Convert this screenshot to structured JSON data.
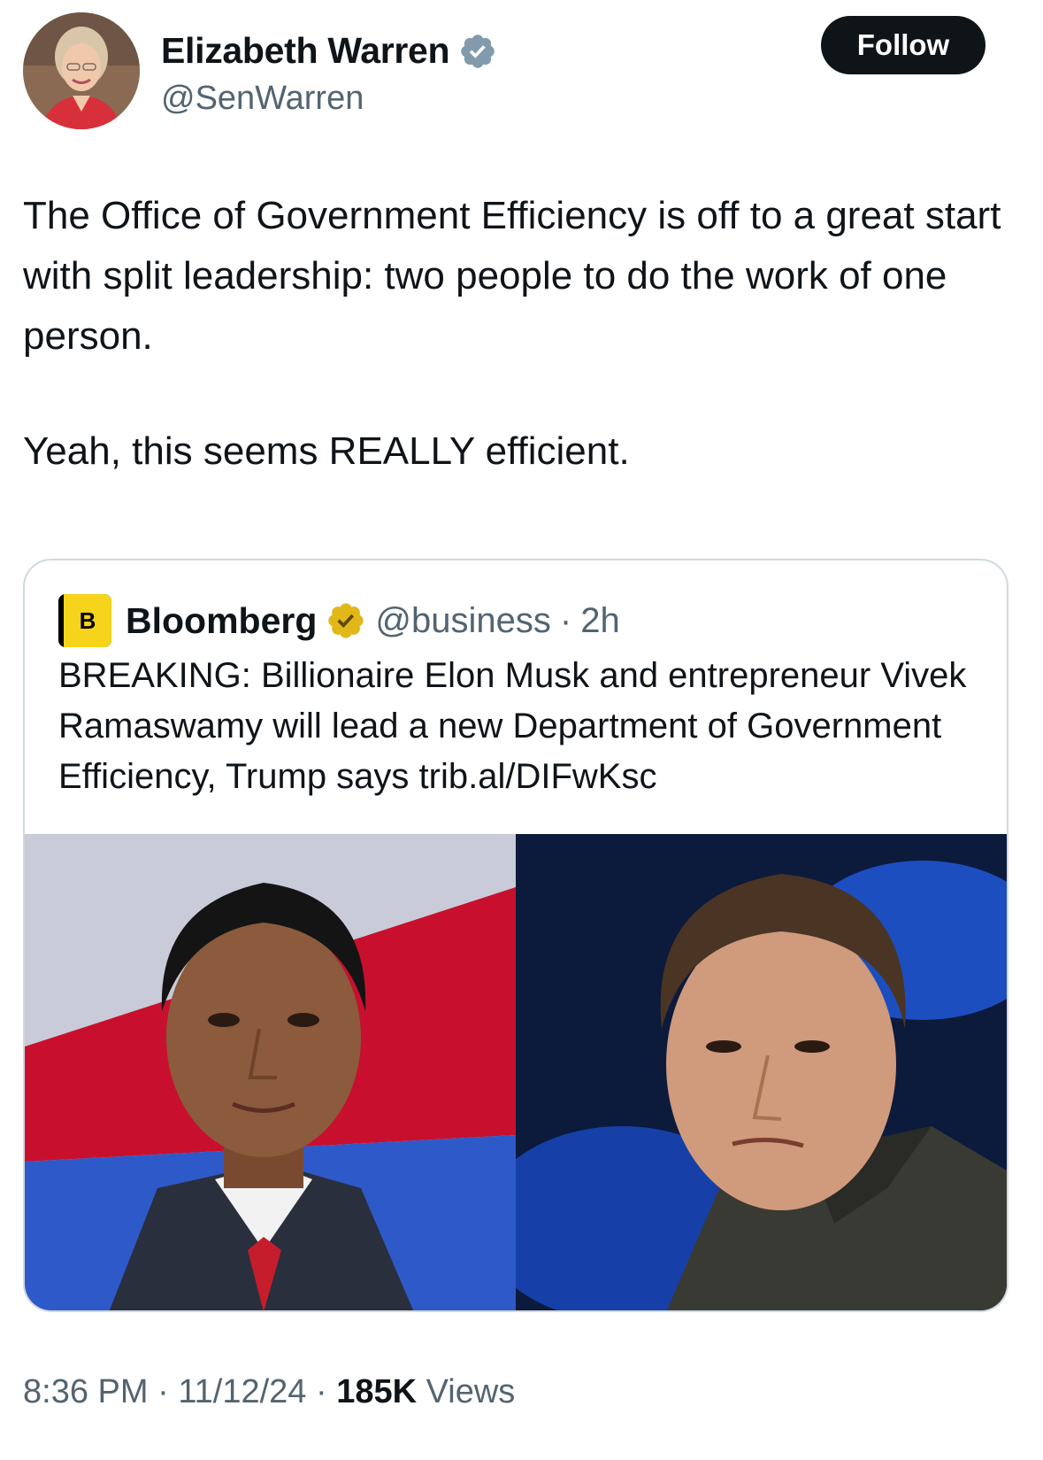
{
  "author": {
    "display_name": "Elizabeth Warren",
    "handle": "@SenWarren",
    "verified_badge_color": "#829aab"
  },
  "follow_button": {
    "label": "Follow"
  },
  "tweet": {
    "paragraphs": [
      "The Office of Government Efficiency is off to a great start with split leadership:  two people to do the work of one person.",
      "Yeah, this seems REALLY efficient."
    ]
  },
  "quote": {
    "logo_letter": "B",
    "name": "Bloomberg",
    "verified_badge_color": "#e2b719",
    "handle": "@business",
    "separator": "·",
    "time": "2h",
    "text": "BREAKING: Billionaire Elon Musk and entrepreneur Vivek Ramaswamy will lead a new Department of Government Efficiency, Trump says trib.al/DIFwKsc"
  },
  "meta": {
    "time": "8:36 PM",
    "separator": "·",
    "date": "11/12/24",
    "views_count": "185K",
    "views_label": "Views"
  },
  "colors": {
    "text_primary": "#0f1419",
    "text_secondary": "#536471",
    "border": "#cfd9de",
    "follow_bg": "#0f1419",
    "bloomberg_yellow": "#f5d41b"
  },
  "icons": {
    "author_verified": "verified-badge-icon",
    "quote_verified": "gold-verified-badge-icon"
  }
}
